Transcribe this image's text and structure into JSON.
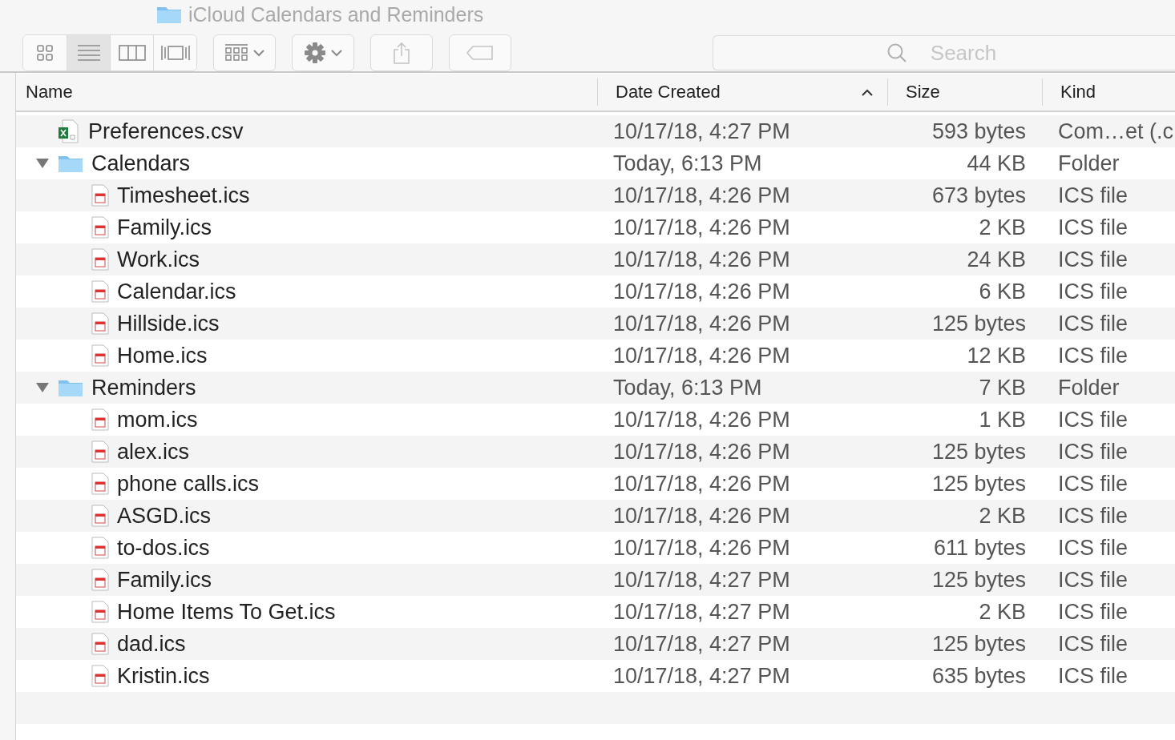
{
  "window": {
    "title": "iCloud Calendars and Reminders"
  },
  "toolbar": {
    "view_buttons": [
      {
        "kind": "icons",
        "selected": false
      },
      {
        "kind": "list",
        "selected": true
      },
      {
        "kind": "columns",
        "selected": false
      },
      {
        "kind": "gallery",
        "selected": false
      }
    ],
    "search": {
      "placeholder": "Search"
    }
  },
  "table": {
    "columns": [
      {
        "label": "Name",
        "sorted": false
      },
      {
        "label": "Date Created",
        "sorted": true
      },
      {
        "label": "Size",
        "sorted": false
      },
      {
        "label": "Kind",
        "sorted": false
      }
    ],
    "rows": [
      {
        "kind": "csv",
        "name": "Preferences.csv",
        "date": "10/17/18, 4:27 PM",
        "size": "593 bytes",
        "type": "Com…et (.c"
      },
      {
        "kind": "folder",
        "expanded": true,
        "name": "Calendars",
        "date": "Today, 6:13 PM",
        "size": "44 KB",
        "type": "Folder",
        "children": [
          {
            "kind": "ics",
            "name": "Timesheet.ics",
            "date": "10/17/18, 4:26 PM",
            "size": "673 bytes",
            "type": "ICS file"
          },
          {
            "kind": "ics",
            "name": "Family.ics",
            "date": "10/17/18, 4:26 PM",
            "size": "2 KB",
            "type": "ICS file"
          },
          {
            "kind": "ics",
            "name": "Work.ics",
            "date": "10/17/18, 4:26 PM",
            "size": "24 KB",
            "type": "ICS file"
          },
          {
            "kind": "ics",
            "name": "Calendar.ics",
            "date": "10/17/18, 4:26 PM",
            "size": "6 KB",
            "type": "ICS file"
          },
          {
            "kind": "ics",
            "name": "Hillside.ics",
            "date": "10/17/18, 4:26 PM",
            "size": "125 bytes",
            "type": "ICS file"
          },
          {
            "kind": "ics",
            "name": "Home.ics",
            "date": "10/17/18, 4:26 PM",
            "size": "12 KB",
            "type": "ICS file"
          }
        ]
      },
      {
        "kind": "folder",
        "expanded": true,
        "name": "Reminders",
        "date": "Today, 6:13 PM",
        "size": "7 KB",
        "type": "Folder",
        "children": [
          {
            "kind": "ics",
            "name": "mom.ics",
            "date": "10/17/18, 4:26 PM",
            "size": "1 KB",
            "type": "ICS file"
          },
          {
            "kind": "ics",
            "name": "alex.ics",
            "date": "10/17/18, 4:26 PM",
            "size": "125 bytes",
            "type": "ICS file"
          },
          {
            "kind": "ics",
            "name": "phone calls.ics",
            "date": "10/17/18, 4:26 PM",
            "size": "125 bytes",
            "type": "ICS file"
          },
          {
            "kind": "ics",
            "name": "ASGD.ics",
            "date": "10/17/18, 4:26 PM",
            "size": "2 KB",
            "type": "ICS file"
          },
          {
            "kind": "ics",
            "name": "to-dos.ics",
            "date": "10/17/18, 4:26 PM",
            "size": "611 bytes",
            "type": "ICS file"
          },
          {
            "kind": "ics",
            "name": "Family.ics",
            "date": "10/17/18, 4:27 PM",
            "size": "125 bytes",
            "type": "ICS file"
          },
          {
            "kind": "ics",
            "name": "Home Items To Get.ics",
            "date": "10/17/18, 4:27 PM",
            "size": "2 KB",
            "type": "ICS file"
          },
          {
            "kind": "ics",
            "name": "dad.ics",
            "date": "10/17/18, 4:27 PM",
            "size": "125 bytes",
            "type": "ICS file"
          },
          {
            "kind": "ics",
            "name": "Kristin.ics",
            "date": "10/17/18, 4:27 PM",
            "size": "635 bytes",
            "type": "ICS file"
          }
        ]
      }
    ]
  }
}
